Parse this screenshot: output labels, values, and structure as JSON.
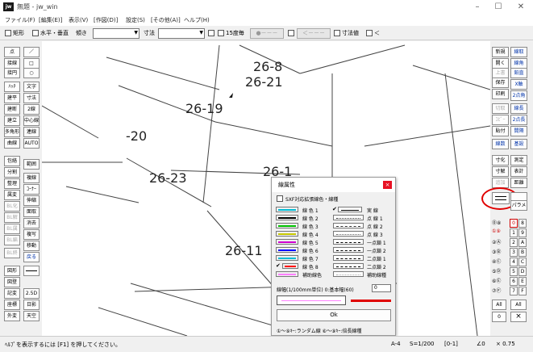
{
  "window": {
    "app_icon": "jw",
    "title": "無題 - jw_win",
    "minimize": "–",
    "maximize": "☐",
    "close": "✕"
  },
  "menu": [
    "ファイル(F)",
    "[編集(E)]",
    "表示(V)",
    "[作図(D)]",
    "設定(S)",
    "[その他(A)]",
    "ヘルプ(H)"
  ],
  "toolbar": {
    "rect": "矩形",
    "hv": "水平・垂直",
    "angle_label": "傾き",
    "dim_label": "寸法",
    "fifteen": "15度毎",
    "arrow1": "●－－－",
    "arrow2": "＜－－－",
    "dim_val": "寸法値",
    "lt": "＜"
  },
  "left_tools": [
    "点",
    "／",
    "接線",
    "□",
    "接円",
    "○",
    "ﾊｯﾁ",
    "文字",
    "建平",
    "寸法",
    "建断",
    "2線",
    "建立",
    "中心線",
    "多角形",
    "連線",
    "曲線",
    "AUTO",
    "包絡",
    "範囲",
    "分割",
    "複線",
    "整理",
    "ｺｰﾅｰ",
    "属変",
    "伸縮",
    "BL化",
    "面取",
    "BL解",
    "消去",
    "BL属",
    "複写",
    "BL編",
    "移動",
    "BL終",
    "戻る",
    "図形",
    "図登",
    "記変",
    "2.5D",
    "座標",
    "日影",
    "外変",
    "天空"
  ],
  "right_tools": [
    "新規",
    "線取",
    "開く",
    "線角",
    "上書",
    "鉛直",
    "保存",
    "X軸",
    "印刷",
    "2点角",
    "切取",
    "線長",
    "ｺﾋﾟｰ",
    "2点長",
    "貼付",
    "間隔",
    "線数",
    "基設",
    "寸化",
    "測定",
    "寸解",
    "表計",
    "追加",
    "距離",
    "",
    "パラメ",
    "All",
    "All",
    "0",
    "×"
  ],
  "layers": {
    "left": [
      "⓪⑧",
      "①⑨",
      "②Ⓐ",
      "③Ⓑ",
      "④Ⓒ",
      "⑤Ⓓ",
      "⑥Ⓔ",
      "⑦Ⓕ"
    ],
    "right": [
      "0",
      "8",
      "1",
      "9",
      "2",
      "A",
      "3",
      "B",
      "4",
      "C",
      "5",
      "D",
      "6",
      "E",
      "7",
      "F"
    ]
  },
  "drawing_labels": [
    "26-8",
    "26-21",
    "26-19",
    "-20",
    "26-23",
    "26-1",
    "26-11"
  ],
  "dialog": {
    "title": "線属性",
    "close": "×",
    "sxf_label": "SXF対応拡張線色・線種",
    "colors": [
      {
        "label": "線 色 1",
        "color": "#00bcd4"
      },
      {
        "label": "線 色 2",
        "color": "#000000"
      },
      {
        "label": "線 色 3",
        "color": "#00c000"
      },
      {
        "label": "線 色 4",
        "color": "#c8c800"
      },
      {
        "label": "線 色 5",
        "color": "#d000d0"
      },
      {
        "label": "線 色 6",
        "color": "#0000ff"
      },
      {
        "label": "線 色 7",
        "color": "#00bcd4"
      },
      {
        "label": "線 色 8",
        "color": "#ff0000"
      },
      {
        "label": "補助線色",
        "color": "#ff80ff"
      }
    ],
    "types": [
      "実 線",
      "点 線 1",
      "点 線 2",
      "点 線 3",
      "一点鎖 1",
      "一点鎖 2",
      "二点鎖 1",
      "二点鎖 2",
      "補助線種"
    ],
    "width_label": "線幅(1/100mm単位) 0:基本幅(60)",
    "width_value": "0",
    "ok": "Ok",
    "hint": "①～⑨ｷｰ:ランダム線  ⑥～⑨ｷｰ:倍長線種"
  },
  "status": {
    "hint": "ﾍﾙﾌﾟを表示するには [F1] を押してください。",
    "paper": "A-4",
    "scale": "S=1/200",
    "layer": "[0-1]",
    "angle": "∠0",
    "zoom": "× 0.75"
  },
  "accent": {
    "red": "#e00000",
    "blue": "#0033aa"
  }
}
